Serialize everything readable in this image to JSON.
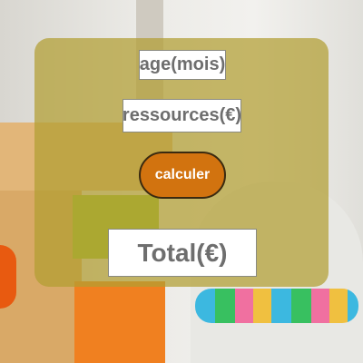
{
  "form": {
    "age_placeholder": "age(mois)",
    "resources_placeholder": "ressources(€)",
    "calculate_label": "calculer",
    "total_placeholder": "Total(€)"
  },
  "colors": {
    "panel": "#b29e32",
    "button": "#d2730f",
    "text": "#6e6e6e"
  }
}
